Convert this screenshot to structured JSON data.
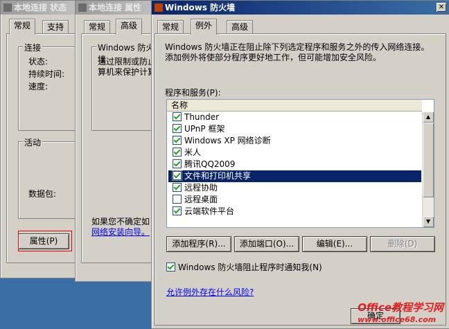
{
  "window1": {
    "title": "本地连接 状态",
    "tabs": [
      "常规",
      "支持"
    ],
    "group_connection": "连接",
    "status_label": "状态:",
    "duration_label": "持续时间:",
    "speed_label": "速度:",
    "group_activity": "活动",
    "packets_label": "数据包:",
    "properties_button": "属性(P)"
  },
  "window2": {
    "title": "本地连接 属性",
    "tabs": [
      "常规",
      "高级"
    ],
    "group_firewall": "Windows 防火墙",
    "firewall_desc": "通过限制或防止\n算机来保护计算",
    "hint_text": "如果您不确定如",
    "wizard_link": "网络安装向导。"
  },
  "window3": {
    "title": "Windows 防火墙",
    "tabs": [
      "常规",
      "例外",
      "高级"
    ],
    "description": "Windows 防火墙正在阻止除下列选定程序和服务之外的传入网络连接。添加例外将使部分程序更好地工作，但可能增加安全风险。",
    "programs_label": "程序和服务(P):",
    "column_name": "名称",
    "programs": [
      {
        "name": "Thunder",
        "checked": true
      },
      {
        "name": "UPnP 框架",
        "checked": true
      },
      {
        "name": "Windows XP 网络诊断",
        "checked": true
      },
      {
        "name": "米人",
        "checked": true
      },
      {
        "name": "腾讯QQ2009",
        "checked": true
      },
      {
        "name": "文件和打印机共享",
        "checked": true
      },
      {
        "name": "远程协助",
        "checked": true
      },
      {
        "name": "远程桌面",
        "checked": false
      },
      {
        "name": "云端软件平台",
        "checked": true
      }
    ],
    "add_program_button": "添加程序(R)...",
    "add_port_button": "添加端口(O)...",
    "edit_button": "编辑(E)...",
    "delete_button": "删除(D)",
    "notify_label": "Windows 防火墙阻止程序时通知我(N)",
    "notify_checked": true,
    "risk_link": "允许例外存在什么风险?",
    "ok_button": "确定"
  },
  "watermark": {
    "brand": "Office教程学习网",
    "url": "www.office68.com"
  }
}
